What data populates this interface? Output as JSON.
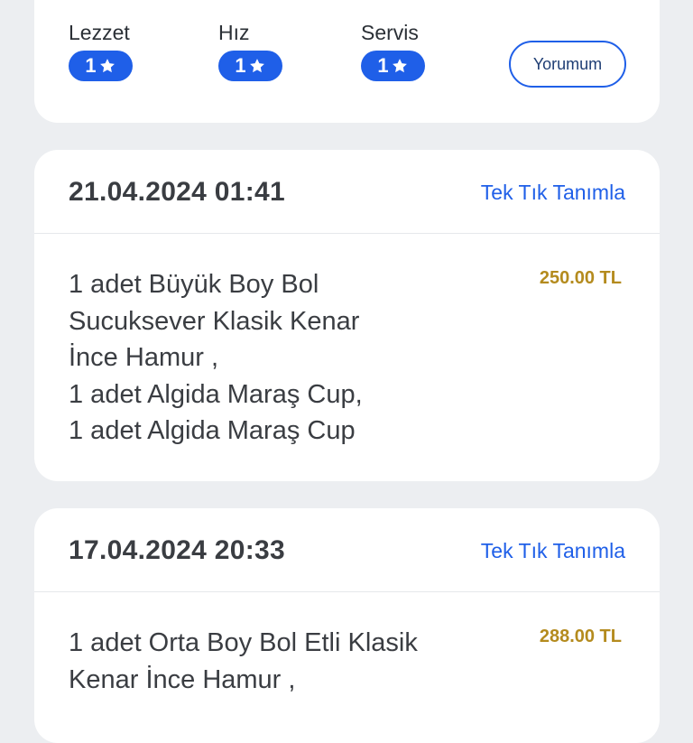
{
  "ratings": [
    {
      "label": "Lezzet",
      "value": "1"
    },
    {
      "label": "Hız",
      "value": "1"
    },
    {
      "label": "Servis",
      "value": "1"
    }
  ],
  "review_button": "Yorumum",
  "icons": {
    "star": "star-icon"
  },
  "colors": {
    "accent": "#1f5fe8",
    "price": "#b48b1e",
    "background": "#eceef1"
  },
  "orders": [
    {
      "datetime": "21.04.2024 01:41",
      "action": "Tek Tık Tanımla",
      "price": "250.00 TL",
      "lines": [
        "1 adet Büyük Boy Bol",
        "Sucuksever Klasik Kenar",
        "İnce Hamur ,",
        "1 adet Algida Maraş Cup,",
        "1 adet Algida Maraş Cup"
      ]
    },
    {
      "datetime": "17.04.2024 20:33",
      "action": "Tek Tık Tanımla",
      "price": "288.00 TL",
      "lines": [
        "1 adet Orta Boy Bol Etli Klasik",
        "Kenar İnce Hamur ,"
      ]
    }
  ]
}
